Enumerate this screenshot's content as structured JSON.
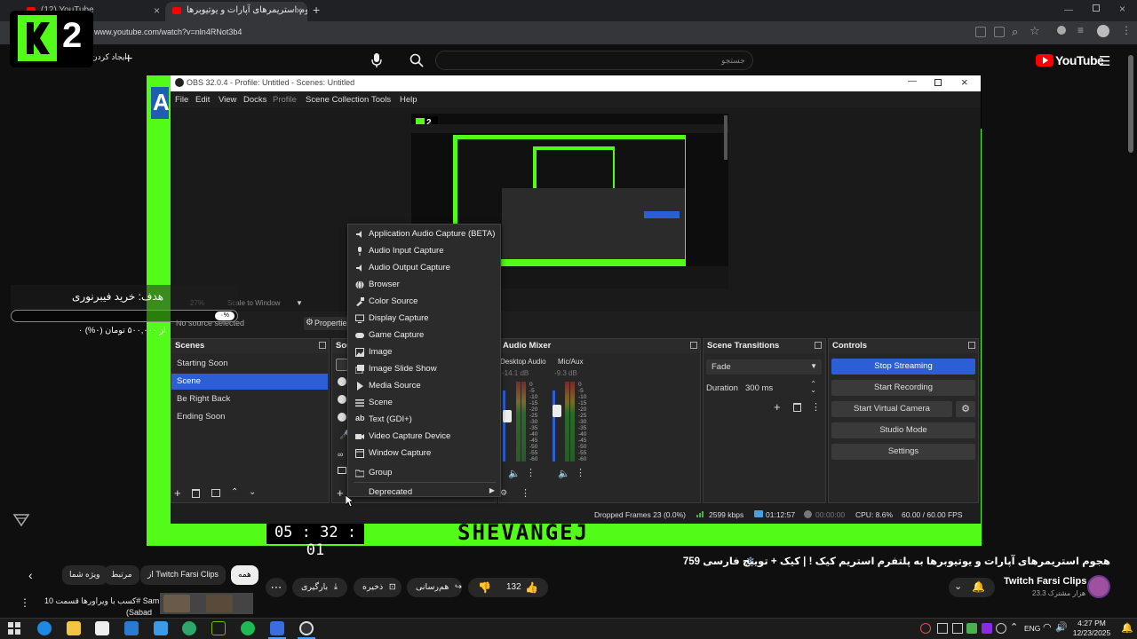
{
  "browser": {
    "tabs": [
      {
        "label": "(12) YouTube"
      },
      {
        "label": "هجوم استریمرهای آپارات و یوتیوبرها"
      }
    ],
    "url": "www.youtube.com/watch?v=nln4RNot3b4"
  },
  "youtube_header": {
    "search_placeholder": "جستجو",
    "logo_text": "YouTube",
    "create_label": "ایجاد کردن"
  },
  "k2_logo": {
    "digit": "2"
  },
  "obs": {
    "window_title": "OBS 32.0.4 - Profile: Untitled - Scenes: Untitled",
    "menu": [
      "File",
      "Edit",
      "View",
      "Docks",
      "Profile",
      "Scene Collection",
      "Tools",
      "Help"
    ],
    "toolbar": {
      "no_source": "No source selected",
      "properties": "Properties",
      "scale_to_window": "Scale to Window",
      "zoom": "27%"
    },
    "scenes": {
      "title": "Scenes",
      "items": [
        "Starting Soon",
        "Scene",
        "Be Right Back",
        "Ending Soon"
      ],
      "selected_index": 1
    },
    "sources_title": "Sou",
    "audio_mixer": {
      "title": "Audio Mixer",
      "channels": [
        {
          "name": "Desktop Audio",
          "db": "-14.1 dB"
        },
        {
          "name": "Mic/Aux",
          "db": "-9.3 dB"
        }
      ],
      "scale": [
        "0",
        "-5",
        "-10",
        "-15",
        "-20",
        "-25",
        "-30",
        "-35",
        "-40",
        "-45",
        "-50",
        "-55",
        "-60"
      ]
    },
    "transitions": {
      "title": "Scene Transitions",
      "selected": "Fade",
      "duration_label": "Duration",
      "duration_value": "300 ms"
    },
    "controls": {
      "title": "Controls",
      "buttons": [
        "Stop Streaming",
        "Start Recording",
        "Start Virtual Camera",
        "Studio Mode",
        "Settings"
      ]
    },
    "statusbar": {
      "dropped": "Dropped Frames 23 (0.0%)",
      "bitrate": "2599 kbps",
      "stream_time": "01:12:57",
      "rec_time": "00:00:00",
      "cpu": "CPU: 8.6%",
      "fps": "60.00 / 60.00 FPS"
    },
    "context_menu": [
      "Application Audio Capture (BETA)",
      "Audio Input Capture",
      "Audio Output Capture",
      "Browser",
      "Color Source",
      "Display Capture",
      "Game Capture",
      "Image",
      "Image Slide Show",
      "Media Source",
      "Scene",
      "Text (GDI+)",
      "Video Capture Device",
      "Window Capture",
      "Group",
      "Deprecated"
    ]
  },
  "stream_overlay": {
    "clock": "05 : 32 : 01",
    "banner": "SHEVANGEJ",
    "goal_text": "هدف: خرید فیبرنوری",
    "goal_pct": "۰%",
    "goal_amount": "۰ از ۵۰۰,۰۰۰ تومان (۰%)"
  },
  "video": {
    "title": "هجوم استریمرهای آپارات و یوتیوبرها به پلتفرم استریم کیک ! | کیک + توییچ فارسی 759",
    "channel": "Twitch Farsi Clips",
    "subscribers": "23.3 هزار مشترک",
    "likes": "132",
    "share": "هم‌رسانی",
    "save": "ذخیره",
    "download": "بارگیری",
    "chips": [
      "همه",
      "از Twitch Farsi Clips",
      "مرتبط",
      "ویژه شما"
    ],
    "related_title": "کسب با ویراورها قسمت 10# Sam",
    "related_sub": "(Sabad"
  },
  "taskbar": {
    "lang": "ENG",
    "time": "4:27 PM",
    "date": "12/23/2025"
  }
}
